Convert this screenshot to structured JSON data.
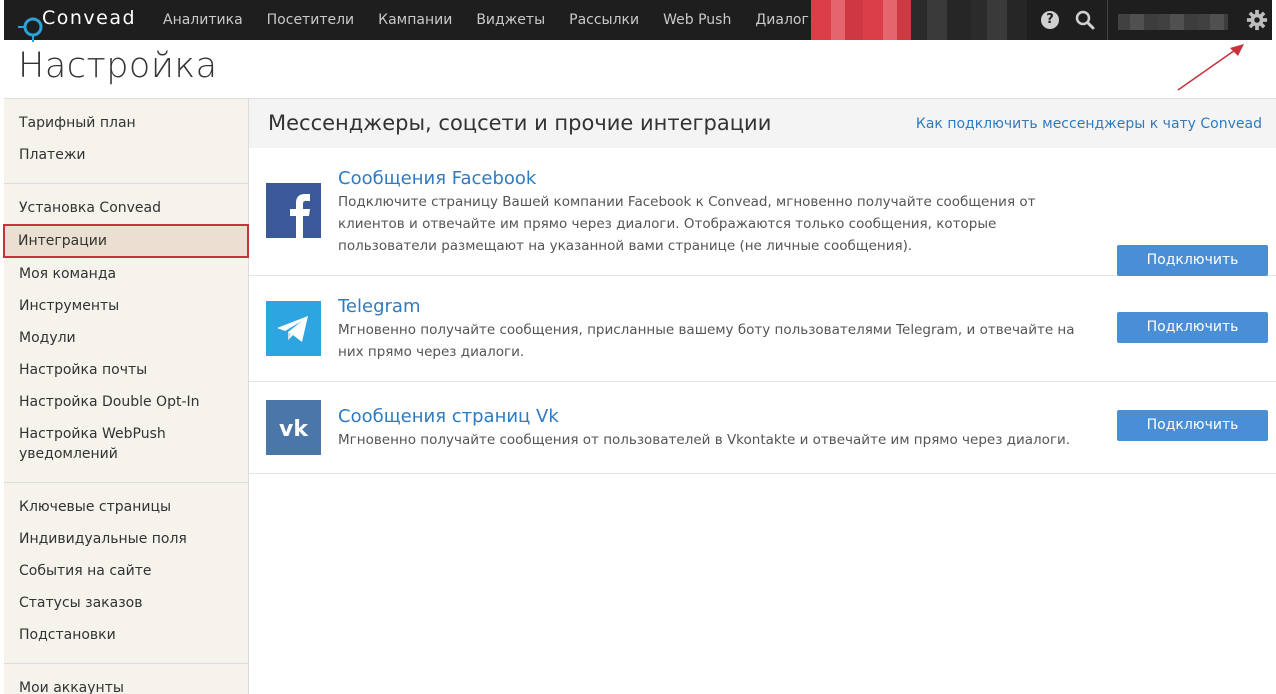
{
  "app": {
    "logo_text": "Convead"
  },
  "topnav": {
    "items": [
      {
        "label": "Аналитика"
      },
      {
        "label": "Посетители"
      },
      {
        "label": "Кампании"
      },
      {
        "label": "Виджеты"
      },
      {
        "label": "Рассылки"
      },
      {
        "label": "Web Push"
      },
      {
        "label": "Диалог"
      }
    ],
    "help_icon": "?",
    "icons": [
      "help-icon",
      "search-icon",
      "gear-icon"
    ]
  },
  "page": {
    "title": "Настройка"
  },
  "sidebar": {
    "groups": [
      {
        "items": [
          {
            "label": "Тарифный план"
          },
          {
            "label": "Платежи"
          }
        ]
      },
      {
        "items": [
          {
            "label": "Установка Convead"
          },
          {
            "label": "Интеграции",
            "active": true
          },
          {
            "label": "Моя команда"
          },
          {
            "label": "Инструменты"
          },
          {
            "label": "Модули"
          },
          {
            "label": "Настройка почты"
          },
          {
            "label": "Настройка Double Opt-In"
          },
          {
            "label": "Настройка WebPush уведомлений"
          }
        ]
      },
      {
        "items": [
          {
            "label": "Ключевые страницы"
          },
          {
            "label": "Индивидуальные поля"
          },
          {
            "label": "События на сайте"
          },
          {
            "label": "Статусы заказов"
          },
          {
            "label": "Подстановки"
          }
        ]
      },
      {
        "items": [
          {
            "label": "Мои аккаунты"
          }
        ]
      }
    ]
  },
  "main": {
    "title": "Мессенджеры, соцсети и прочие интеграции",
    "help_link": "Как подключить мессенджеры к чату Convead",
    "integrations": [
      {
        "title": "Сообщения Facebook",
        "description": "Подключите страницу Вашей компании Facebook к Convead, мгновенно получайте сообщения от клиентов и отвечайте им прямо через диалоги. Отображаются только сообщения, которые пользователи размещают на указанной вами странице (не личные сообщения).",
        "button": "Подключить",
        "icon": "facebook-icon",
        "color": "#3b5998"
      },
      {
        "title": "Telegram",
        "description": "Мгновенно получайте сообщения, присланные вашему боту пользователями Telegram, и отвечайте на них прямо через диалоги.",
        "button": "Подключить",
        "icon": "telegram-icon",
        "color": "#2ca5e0"
      },
      {
        "title": "Сообщения страниц Vk",
        "description": "Мгновенно получайте сообщения от пользователей в Vkontakte и отвечайте им прямо через диалоги.",
        "button": "Подключить",
        "icon": "vk-icon",
        "color": "#4a76a8"
      }
    ]
  },
  "colors": {
    "topbar": "#1e1e1e",
    "link": "#2f7bbf",
    "button": "#4a8fd6",
    "sidebar_bg": "#f6f3ec",
    "active_border": "#c8323a",
    "annotation_arrow": "#c8323a"
  }
}
